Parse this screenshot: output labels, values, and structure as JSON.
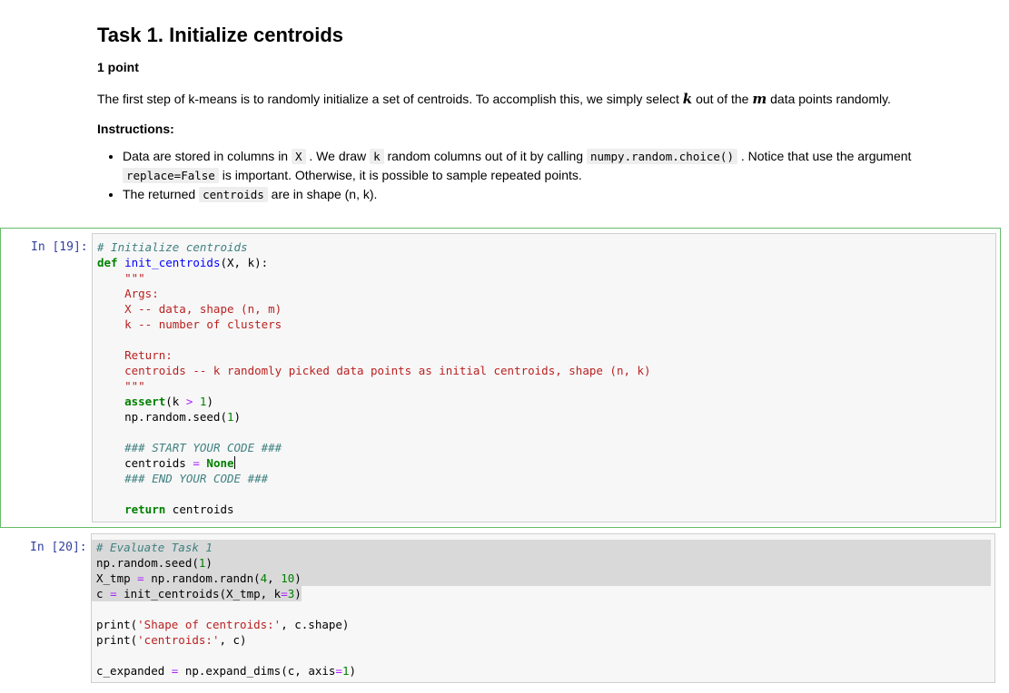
{
  "markdown": {
    "title": "Task 1. Initialize centroids",
    "points": "1 point",
    "intro_a": "The first step of k-means is to randomly initialize a set of centroids. To accomplish this, we simply select ",
    "intro_k": "k",
    "intro_b": " out of the ",
    "intro_m": "m",
    "intro_c": " data points randomly.",
    "instructions_label": "Instructions:",
    "bullet1": {
      "t1": "Data are stored in columns in ",
      "c1": "X",
      "t2": " . We draw ",
      "c2": "k",
      "t3": " random columns out of it by calling ",
      "c3": "numpy.random.choice()",
      "t4": " . Notice that use the argument ",
      "c4": "replace=False",
      "t5": " is important. Otherwise, it is possible to sample repeated points."
    },
    "bullet2": {
      "t1": "The returned ",
      "c1": "centroids",
      "t2": " are in shape (n, k)."
    }
  },
  "cell19": {
    "prompt": "In [19]:",
    "l1": "# Initialize centroids",
    "l2_def": "def",
    "l2_fn": "init_centroids",
    "l2_rest": "(X, k):",
    "doc_open": "    \"\"\"",
    "doc1": "    Args:",
    "doc2": "    X -- data, shape (n, m)",
    "doc3": "    k -- number of clusters",
    "doc4": "    Return:",
    "doc5": "    centroids -- k randomly picked data points as initial centroids, shape (n, k)",
    "doc_close": "    \"\"\"",
    "assert_kw": "assert",
    "assert_a": "(k ",
    "assert_op": ">",
    "assert_sp": " ",
    "assert_n": "1",
    "assert_b": ")",
    "seed_a": "    np.random.seed(",
    "seed_n": "1",
    "seed_b": ")",
    "start_cm": "### START YOUR CODE ###",
    "cent_a": "    centroids ",
    "cent_op": "=",
    "cent_sp": " ",
    "cent_none": "None",
    "end_cm": "### END YOUR CODE ###",
    "ret_kw": "return",
    "ret_rest": " centroids"
  },
  "cell20": {
    "prompt": "In [20]:",
    "l1": "# Evaluate Task 1",
    "l2a": "np.random.seed(",
    "l2n": "1",
    "l2b": ")",
    "l3a": "X_tmp ",
    "l3op": "=",
    "l3b": " np.random.randn(",
    "l3n1": "4",
    "l3c": ", ",
    "l3n2": "10",
    "l3d": ")",
    "l4a": "c ",
    "l4op": "=",
    "l4b": " init_centroids(X_tmp, k",
    "l4op2": "=",
    "l4n": "3",
    "l4c": ")",
    "l5a": "print(",
    "l5s": "'Shape of centroids:'",
    "l5b": ", c.shape)",
    "l6a": "print(",
    "l6s": "'centroids:'",
    "l6b": ", c)",
    "l7a": "c_expanded ",
    "l7op": "=",
    "l7b": " np.expand_dims(c, axis",
    "l7op2": "=",
    "l7n": "1",
    "l7c": ")"
  }
}
